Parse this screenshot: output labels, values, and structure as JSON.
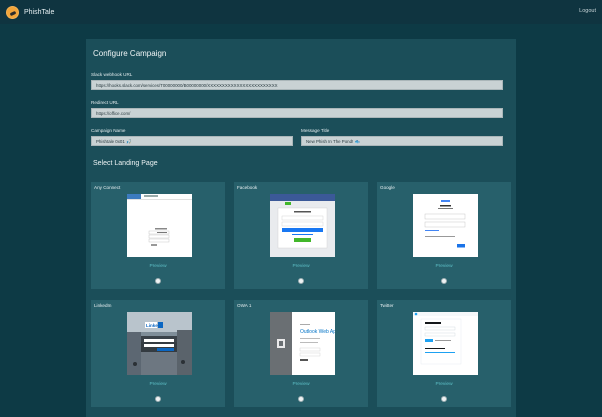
{
  "header": {
    "app_title": "PhishTale",
    "logout_label": "Logout",
    "logo_icon": "fish-hook-logo-icon"
  },
  "form": {
    "title": "Configure Campaign",
    "slack_label": "Slack webhook URL",
    "slack_value": "https://hooks.slack.com/services/T00000000/B00000000/XXXXXXXXXXXXXXXXXXXXXXXX",
    "redirect_label": "Redirect URL",
    "redirect_value": "https://office.com/",
    "campaign_label": "Campaign Name",
    "campaign_value": "Phishtale 0x01 🎣",
    "message_label": "Message Title",
    "message_value": "New Phish In The Pond! 🐟"
  },
  "landing": {
    "title": "Select Landing Page",
    "preview_label": "Preview",
    "cards": [
      {
        "name": "Any Connect"
      },
      {
        "name": "Facebook"
      },
      {
        "name": "Google"
      },
      {
        "name": "LinkedIn"
      },
      {
        "name": "OWA 1"
      },
      {
        "name": "Twitter"
      }
    ]
  },
  "colors": {
    "background": "#0d3a45",
    "panel": "#1b4e59",
    "card": "#27606b",
    "preview_link": "#5ec1c8"
  }
}
